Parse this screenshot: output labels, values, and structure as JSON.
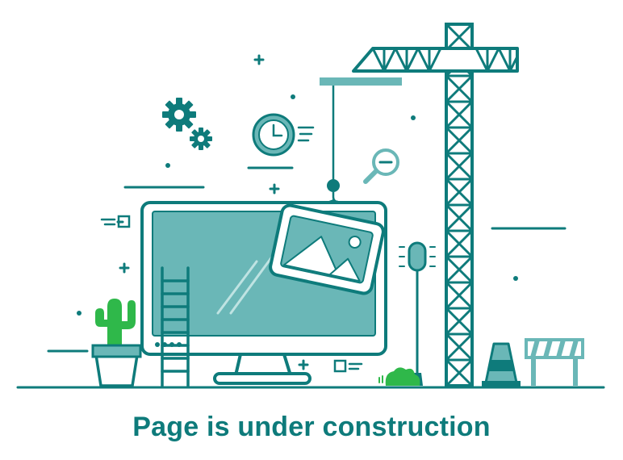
{
  "message": "Page is under construction",
  "colors": {
    "primary": "#0e7b7b",
    "screen": "#6ab7b7",
    "light": "#bfe3e2",
    "accent_green": "#2fb84a",
    "background": "#ffffff"
  },
  "icons": [
    "gear-icon",
    "clock-icon",
    "magnifier-icon",
    "crane-icon",
    "monitor-icon",
    "image-frame-icon",
    "cactus-icon",
    "ladder-icon",
    "lamp-icon",
    "traffic-cone-icon",
    "barrier-icon",
    "bush-icon"
  ]
}
